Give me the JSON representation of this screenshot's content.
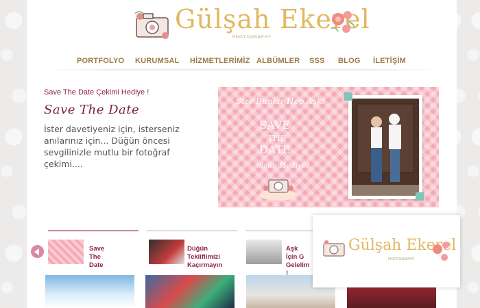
{
  "brand": {
    "name": "Gülşah Ekerel",
    "sub": "PHOTOGRAPHY"
  },
  "nav": {
    "items": [
      "PORTFOLYO",
      "KURUMSAL",
      "HİZMETLERİMİZ",
      "ALBÜMLER",
      "SSS",
      "BLOG",
      "İLETİŞİM"
    ]
  },
  "hero": {
    "kicker": "Save The Date Çekimi Hediye !",
    "title": "Save The Date",
    "body": "İster davetiyeniz için, isterseniz anılarınız için... Düğün öncesi sevgilinizle mutlu bir fotoğraf çekimi....",
    "image_text": {
      "script_top": "Size Bunlar Hep Aşk!",
      "big_line1": "SAVE",
      "big_line2": "THE",
      "big_line3": "DATE",
      "script_bottom": "olsun Hediye!"
    }
  },
  "slider": {
    "items": [
      {
        "label": "Save The Date"
      },
      {
        "label_line1": "Düğün",
        "label_line2": "Tekliflimizi",
        "label_line3": "Kaçırmayın"
      },
      {
        "label_line1": "Aşk İçin G",
        "label_line2": "Gelelim !"
      }
    ]
  },
  "colors": {
    "accent": "#8d2342",
    "nav": "#9b7a45",
    "hero_bg": "#f5aab6",
    "arrow": "#d989a6",
    "logo_gold": "#e1b860"
  }
}
